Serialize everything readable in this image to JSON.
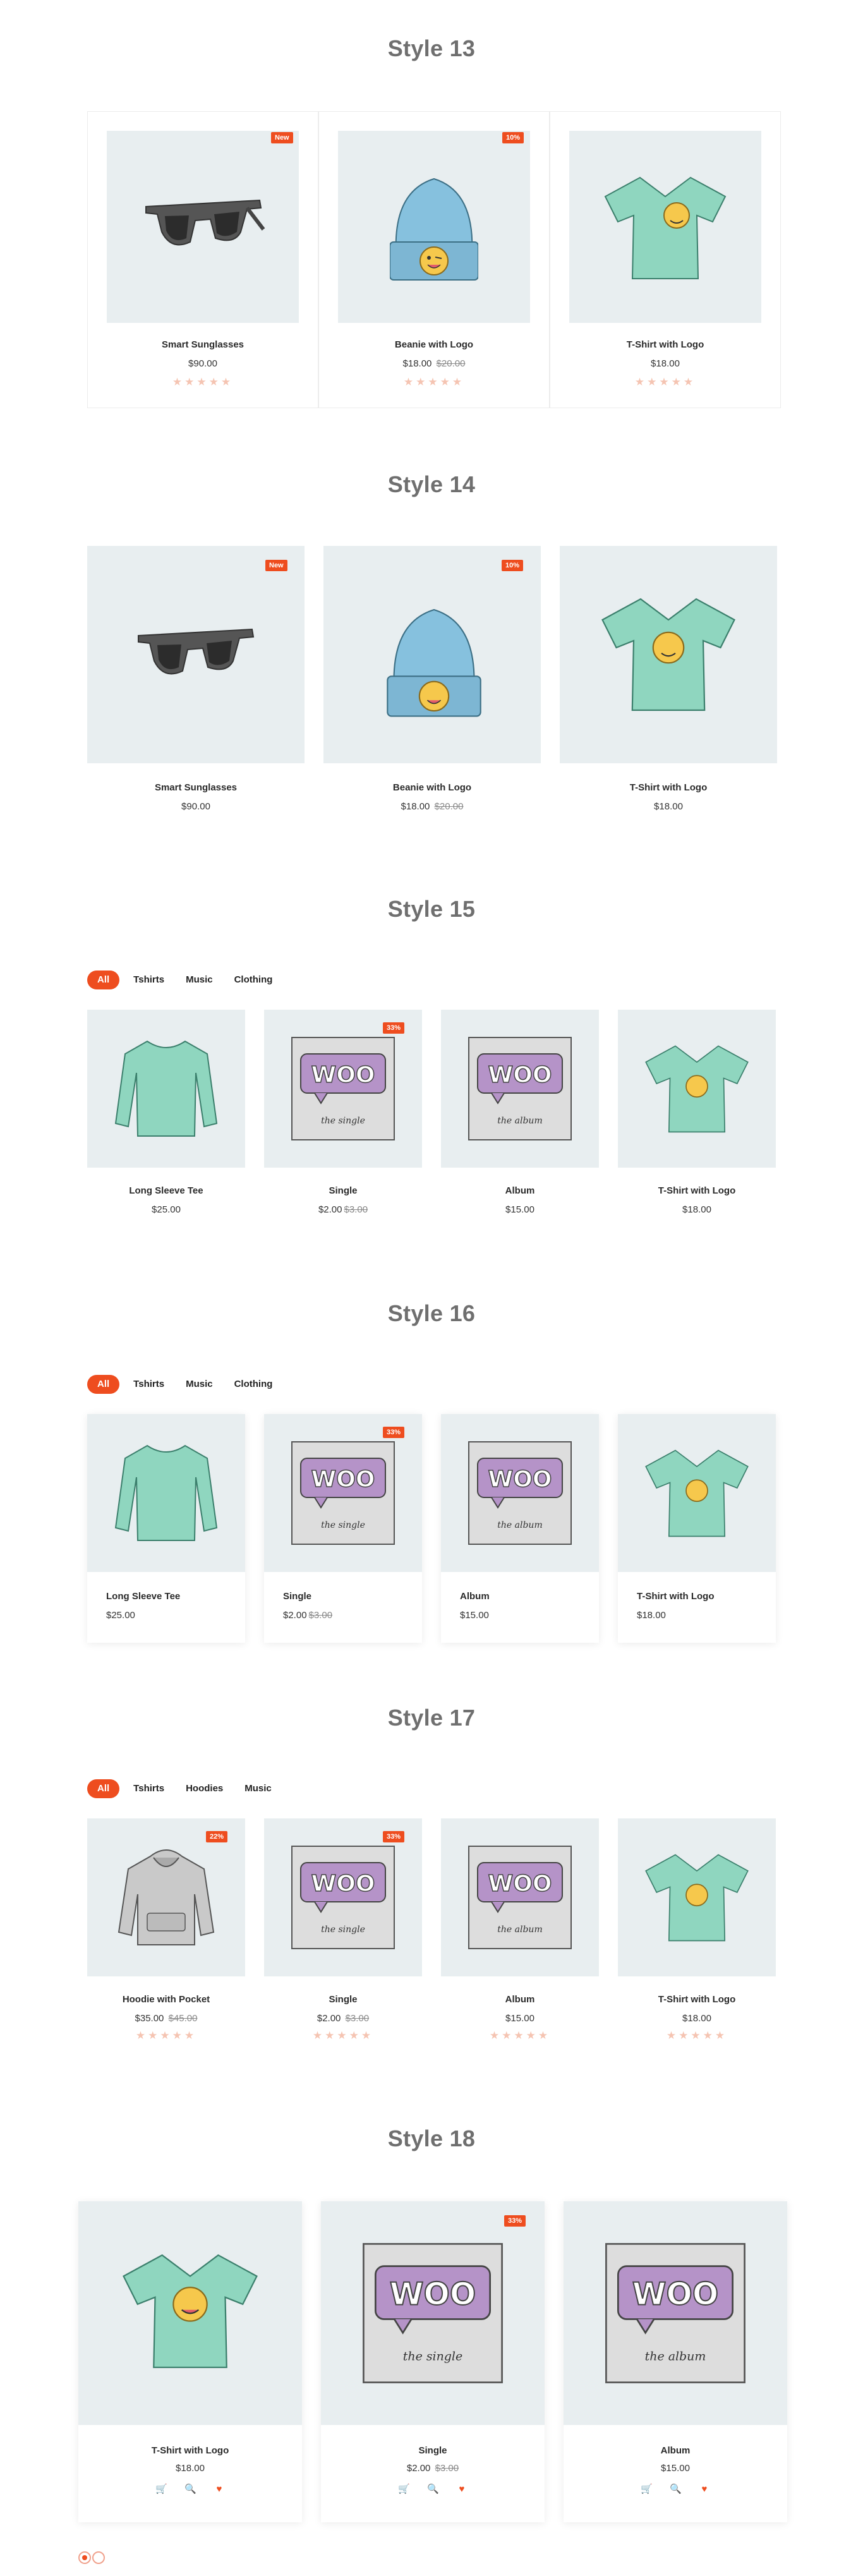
{
  "colors": {
    "accent": "#ee4d1f",
    "image_bg": "#e8eef0",
    "title": "#6f6f6f"
  },
  "icons": {
    "cart": "cart-icon",
    "search": "search-icon",
    "wishlist": "heart-icon"
  },
  "style13": {
    "title": "Style 13",
    "products": [
      {
        "name": "Smart Sunglasses",
        "price": "$90.00",
        "old": "",
        "badge": "New",
        "stars": "★★★★★"
      },
      {
        "name": "Beanie with Logo",
        "price": "$18.00",
        "old": "$20.00",
        "badge": "10%",
        "stars": "★★★★★"
      },
      {
        "name": "T-Shirt with Logo",
        "price": "$18.00",
        "old": "",
        "badge": "",
        "stars": "★★★★★"
      }
    ]
  },
  "style14": {
    "title": "Style 14",
    "products": [
      {
        "name": "Smart Sunglasses",
        "price": "$90.00",
        "old": "",
        "badge": "New"
      },
      {
        "name": "Beanie with Logo",
        "price": "$18.00",
        "old": "$20.00",
        "badge": "10%"
      },
      {
        "name": "T-Shirt with Logo",
        "price": "$18.00",
        "old": "",
        "badge": ""
      }
    ]
  },
  "style15": {
    "title": "Style 15",
    "tabs": [
      "All",
      "Tshirts",
      "Music",
      "Clothing"
    ],
    "products": [
      {
        "name": "Long Sleeve Tee",
        "price": "$25.00",
        "old": "",
        "badge": ""
      },
      {
        "name": "Single",
        "price": "$2.00",
        "old": "$3.00",
        "badge": "33%"
      },
      {
        "name": "Album",
        "price": "$15.00",
        "old": "",
        "badge": ""
      },
      {
        "name": "T-Shirt with Logo",
        "price": "$18.00",
        "old": "",
        "badge": ""
      }
    ]
  },
  "style16": {
    "title": "Style 16",
    "tabs": [
      "All",
      "Tshirts",
      "Music",
      "Clothing"
    ],
    "products": [
      {
        "name": "Long Sleeve Tee",
        "price": "$25.00",
        "old": "",
        "badge": ""
      },
      {
        "name": "Single",
        "price": "$2.00",
        "old": "$3.00",
        "badge": "33%"
      },
      {
        "name": "Album",
        "price": "$15.00",
        "old": "",
        "badge": ""
      },
      {
        "name": "T-Shirt with Logo",
        "price": "$18.00",
        "old": "",
        "badge": ""
      }
    ]
  },
  "style17": {
    "title": "Style 17",
    "tabs": [
      "All",
      "Tshirts",
      "Hoodies",
      "Music"
    ],
    "products": [
      {
        "name": "Hoodie with Pocket",
        "price": "$35.00",
        "old": "$45.00",
        "badge": "22%",
        "stars": "★★★★★"
      },
      {
        "name": "Single",
        "price": "$2.00",
        "old": "$3.00",
        "badge": "33%",
        "stars": "★★★★★"
      },
      {
        "name": "Album",
        "price": "$15.00",
        "old": "",
        "badge": "",
        "stars": "★★★★★"
      },
      {
        "name": "T-Shirt with Logo",
        "price": "$18.00",
        "old": "",
        "badge": "",
        "stars": "★★★★★"
      }
    ]
  },
  "style18": {
    "title": "Style 18",
    "products": [
      {
        "name": "T-Shirt with Logo",
        "price": "$18.00",
        "old": "",
        "badge": ""
      },
      {
        "name": "Single",
        "price": "$2.00",
        "old": "$3.00",
        "badge": "33%"
      },
      {
        "name": "Album",
        "price": "$15.00",
        "old": "",
        "badge": ""
      }
    ],
    "action_glyphs": {
      "cart": "🛒",
      "search": "🔍",
      "wishlist": "♥"
    }
  },
  "woo_art": {
    "logo_text": "WOO",
    "single_caption": "the single",
    "album_caption": "the album"
  }
}
